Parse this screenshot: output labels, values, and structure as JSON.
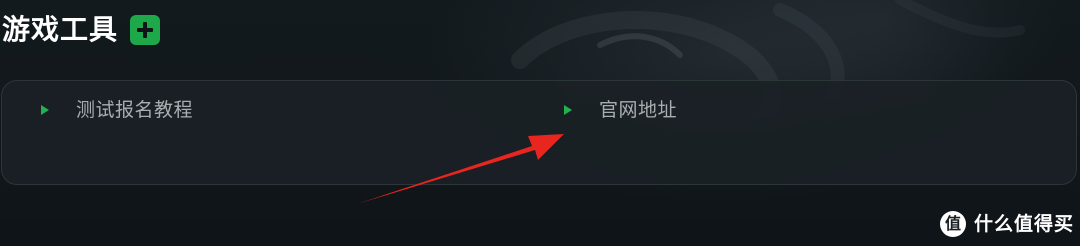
{
  "section": {
    "title": "游戏工具",
    "add_icon": "plus-square-icon"
  },
  "tools": [
    {
      "label": "测试报名教程",
      "icon": "play-triangle-icon"
    },
    {
      "label": "官网地址",
      "icon": "play-triangle-icon"
    }
  ],
  "annotation": {
    "icon": "red-arrow-icon",
    "color": "#e8251e"
  },
  "watermark": {
    "logo_glyph": "值",
    "text": "什么值得买"
  },
  "colors": {
    "accent_green": "#1ea84a",
    "background": "#11161a",
    "panel": "#1a2125",
    "label_gray": "#a8adb0"
  }
}
